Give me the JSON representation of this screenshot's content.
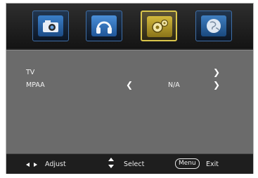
{
  "tabs": [
    {
      "icon": "camera-icon"
    },
    {
      "icon": "headphones-icon"
    },
    {
      "icon": "gear-icon",
      "active": true
    },
    {
      "icon": "globe-icon"
    }
  ],
  "rows": [
    {
      "label": "TV",
      "value": ""
    },
    {
      "label": "MPAA",
      "value": "N/A"
    }
  ],
  "footer": {
    "adjust": "Adjust",
    "select": "Select",
    "menu_key": "Menu",
    "exit": "Exit"
  },
  "colors": {
    "accent_active": "#d9c54b",
    "tab_border": "#3f6fa8",
    "content_bg": "#6b6b6b",
    "frame_bg": "#1f1f1f"
  }
}
